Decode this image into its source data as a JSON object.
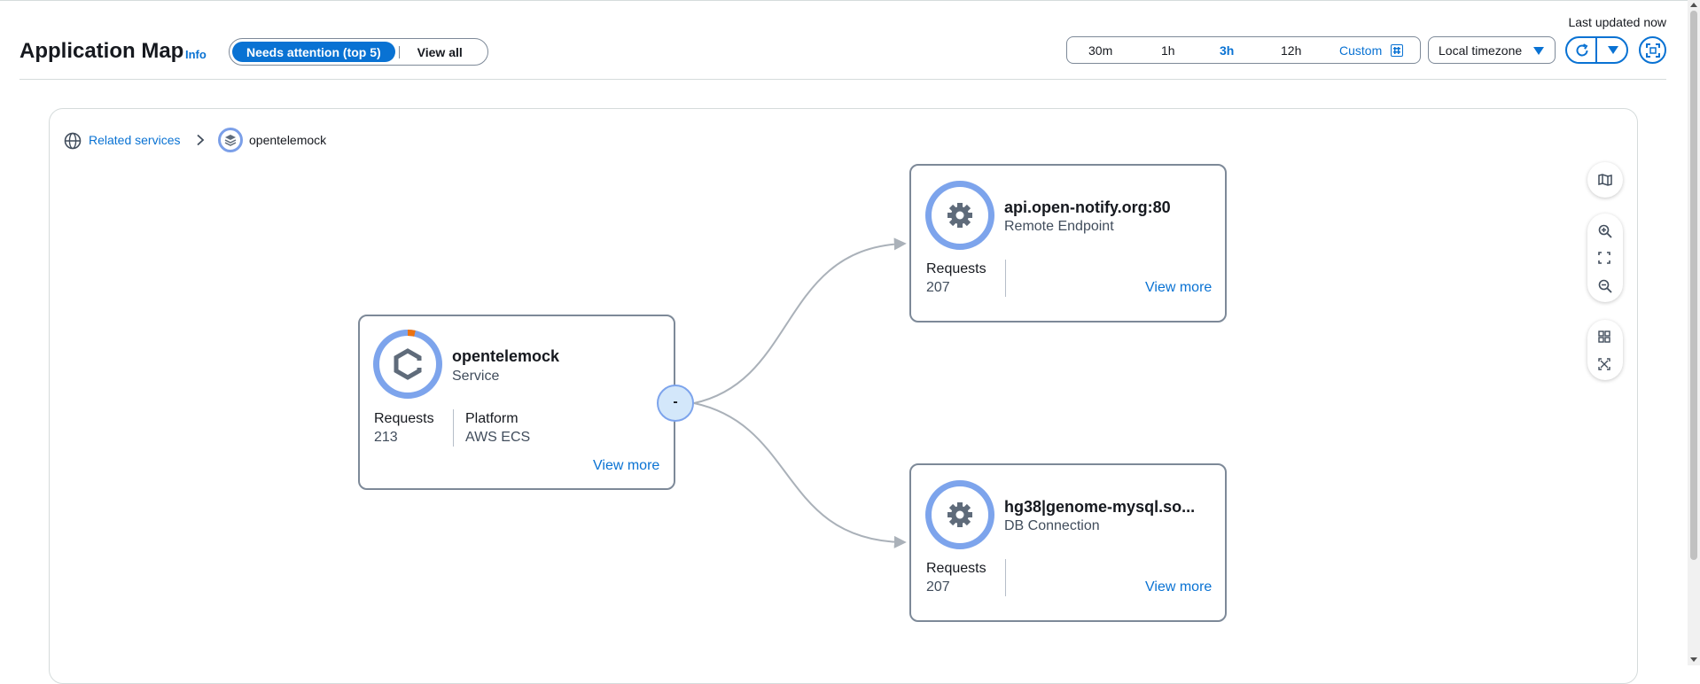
{
  "header": {
    "title": "Application Map",
    "info_label": "Info",
    "filter": {
      "active_label": "Needs attention (top 5)",
      "other_label": "View all"
    },
    "last_updated": "Last updated now",
    "time_range": {
      "options": [
        "30m",
        "1h",
        "3h",
        "12h"
      ],
      "selected": "3h",
      "custom_label": "Custom"
    },
    "timezone": "Local timezone"
  },
  "breadcrumb": {
    "root_label": "Related services",
    "current_label": "opentelemock"
  },
  "nodes": {
    "service": {
      "name": "opentelemock",
      "type": "Service",
      "requests_label": "Requests",
      "requests_value": "213",
      "platform_label": "Platform",
      "platform_value": "AWS ECS",
      "view_more": "View more"
    },
    "remote": {
      "name": "api.open-notify.org:80",
      "type": "Remote Endpoint",
      "requests_label": "Requests",
      "requests_value": "207",
      "view_more": "View more"
    },
    "db": {
      "name": "hg38|genome-mysql.so...",
      "type": "DB Connection",
      "requests_label": "Requests",
      "requests_value": "207",
      "view_more": "View more"
    }
  },
  "collapse_label": "-",
  "colors": {
    "accent": "#0972d3",
    "ring": "#7da4ec",
    "warning_arc": "#ec7211",
    "edge": "#aab1b9"
  },
  "icons": [
    "map-icon",
    "zoom-in-icon",
    "fit-view-icon",
    "zoom-out-icon",
    "grid-layout-icon",
    "expand-nodes-icon",
    "refresh-icon",
    "fullscreen-icon",
    "globe-icon",
    "gear-icon",
    "service-icon"
  ]
}
